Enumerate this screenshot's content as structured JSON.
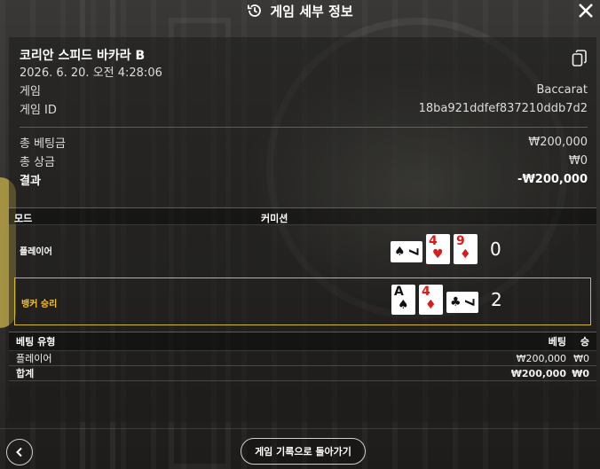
{
  "header": {
    "title": "게임 세부 정보",
    "icon": "history-icon",
    "close_icon": "close-icon"
  },
  "game": {
    "table_name": "코리안 스피드 바카라 B",
    "datetime": "2026. 6. 20. 오전 4:28:06",
    "game_label": "게임",
    "game_value": "Baccarat",
    "id_label": "게임 ID",
    "id_value": "18ba921ddfef837210ddb7d2",
    "copy_icon": "copy-icon"
  },
  "summary": {
    "total_bet_label": "총 베팅금",
    "total_bet_value": "₩200,000",
    "total_win_label": "총 상금",
    "total_win_value": "₩0",
    "result_label": "결과",
    "result_value": "-₩200,000"
  },
  "columns": {
    "mode": "모드",
    "commission": "커미션"
  },
  "hands": {
    "player": {
      "label": "플레이어",
      "score": "0",
      "cards": [
        {
          "rank": "7",
          "suit": "♠",
          "color": "black",
          "orientation": "side"
        },
        {
          "rank": "4",
          "suit": "♥",
          "color": "red",
          "orientation": "upright"
        },
        {
          "rank": "9",
          "suit": "♦",
          "color": "red",
          "orientation": "upright"
        }
      ]
    },
    "banker": {
      "label": "뱅커 승리",
      "score": "2",
      "cards": [
        {
          "rank": "A",
          "suit": "♠",
          "color": "black",
          "orientation": "upright"
        },
        {
          "rank": "4",
          "suit": "♦",
          "color": "red",
          "orientation": "upright"
        },
        {
          "rank": "7",
          "suit": "♣",
          "color": "black",
          "orientation": "side"
        }
      ]
    }
  },
  "bets": {
    "headers": {
      "type": "베팅 유형",
      "bet": "베팅",
      "win": "승"
    },
    "rows": [
      {
        "type": "플레이어",
        "bet": "₩200,000",
        "win": "₩0"
      }
    ],
    "total": {
      "type": "합계",
      "bet": "₩200,000",
      "win": "₩0"
    }
  },
  "footer": {
    "back_icon": "chevron-left-icon",
    "history_button": "게임 기록으로 돌아가기"
  },
  "colors": {
    "banker_highlight": "#d4b82a",
    "banker_label": "#f2c230",
    "red_suit": "#d81b1b"
  }
}
